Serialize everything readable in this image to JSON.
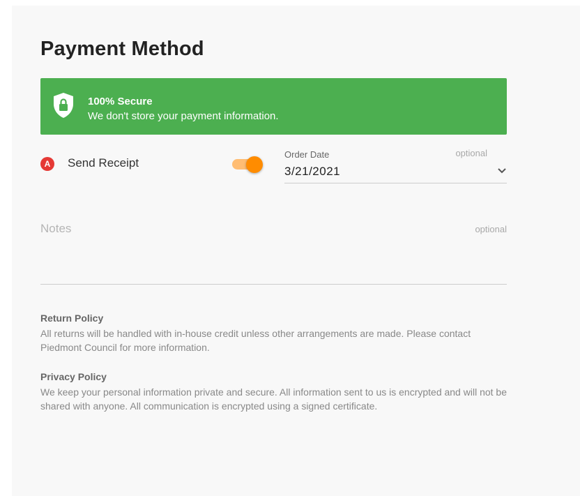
{
  "page": {
    "title": "Payment Method"
  },
  "secure_banner": {
    "title": "100% Secure",
    "subtitle": "We don't store your payment information.",
    "icon": "shield-lock-icon",
    "color": "#4caf50"
  },
  "send_receipt": {
    "badge": "A",
    "label": "Send Receipt",
    "toggle_on": true,
    "toggle_color": "#ff8c00"
  },
  "order_date": {
    "label": "Order Date",
    "optional": "optional",
    "value": "3/21/2021"
  },
  "notes": {
    "placeholder": "Notes",
    "optional": "optional"
  },
  "return_policy": {
    "title": "Return Policy",
    "text": "All returns will be handled with in-house credit unless other arrangements are made. Please contact Piedmont Council for more information."
  },
  "privacy_policy": {
    "title": "Privacy Policy",
    "text": "We keep your personal information private and secure. All information sent to us is encrypted and will not be shared with anyone. All communication is encrypted using a signed certificate."
  }
}
